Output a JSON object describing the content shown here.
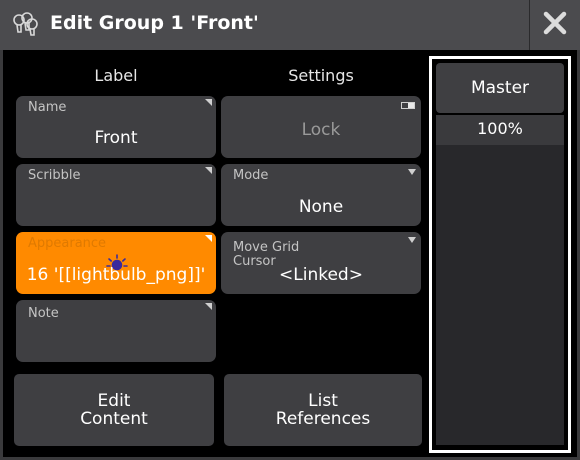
{
  "title": "Edit Group 1 'Front'",
  "columns": {
    "label": "Label",
    "settings": "Settings"
  },
  "name_field": {
    "label": "Name",
    "value": "Front"
  },
  "scribble_field": {
    "label": "Scribble",
    "value": ""
  },
  "appearance_field": {
    "label": "Appearance",
    "value": "16 '[[lightbulb_png]]'"
  },
  "note_field": {
    "label": "Note",
    "value": ""
  },
  "lock_button": {
    "label": "Lock"
  },
  "mode_field": {
    "label": "Mode",
    "value": "None"
  },
  "move_grid_cursor_field": {
    "label_line1": "Move Grid",
    "label_line2": "Cursor",
    "value": "<Linked>"
  },
  "edit_content_button": {
    "line1": "Edit",
    "line2": "Content"
  },
  "list_references_button": {
    "line1": "List",
    "line2": "References"
  },
  "master": {
    "label": "Master",
    "value": "100%",
    "level": 1.0
  },
  "colors": {
    "accent": "#ff8a00",
    "button": "#3f3f42",
    "titlebar": "#4b4b4e"
  },
  "icons": {
    "title": "lightbulbs-icon",
    "close": "close-icon",
    "appearance": "lightbulb-icon"
  }
}
